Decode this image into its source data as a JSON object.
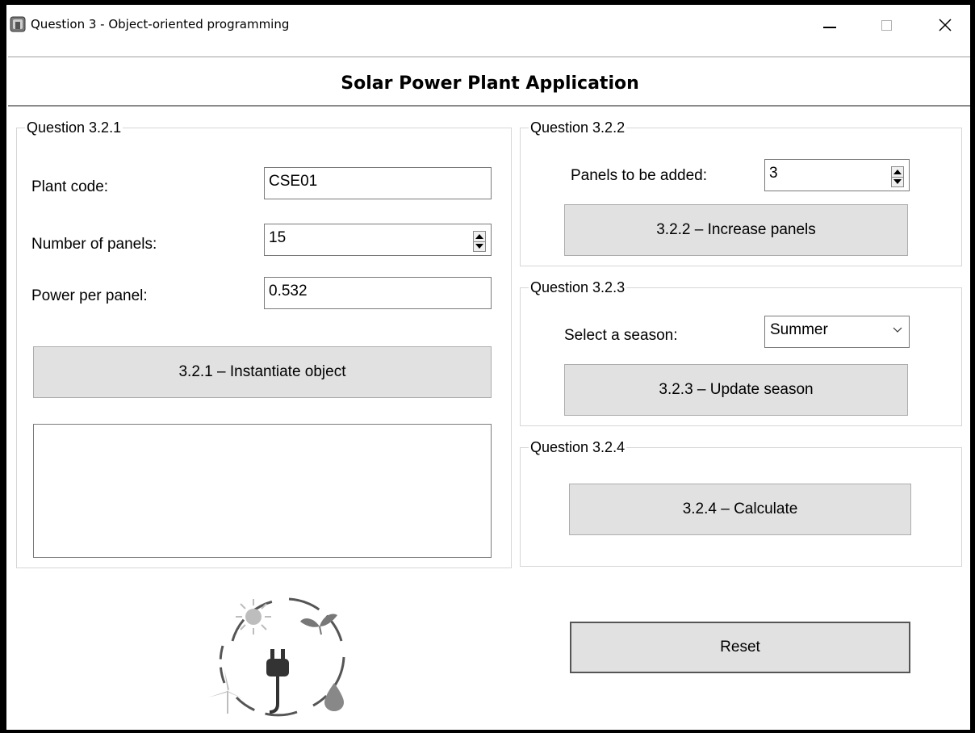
{
  "window": {
    "title": "Question 3 - Object-oriented programming",
    "minimize_glyph": "—",
    "maximize_glyph": "☐",
    "close_glyph": "✕"
  },
  "header": {
    "title": "Solar Power Plant Application"
  },
  "q321": {
    "caption": "Question 3.2.1",
    "plant_code_label": "Plant code:",
    "plant_code_value": "CSE01",
    "num_panels_label": "Number of panels:",
    "num_panels_value": "15",
    "power_label": "Power per panel:",
    "power_value": "0.532",
    "button_label": "3.2.1 – Instantiate object"
  },
  "q322": {
    "caption": "Question 3.2.2",
    "panels_label": "Panels to be added:",
    "panels_value": "3",
    "button_label": "3.2.2 – Increase panels"
  },
  "q323": {
    "caption": "Question 3.2.3",
    "season_label": "Select a season:",
    "season_value": "Summer",
    "button_label": "3.2.3 – Update season"
  },
  "q324": {
    "caption": "Question 3.2.4",
    "button_label": "3.2.4 – Calculate"
  },
  "reset_label": "Reset",
  "icons": {
    "app": "app-icon",
    "logo": "renewable-energy-logo-icon"
  }
}
